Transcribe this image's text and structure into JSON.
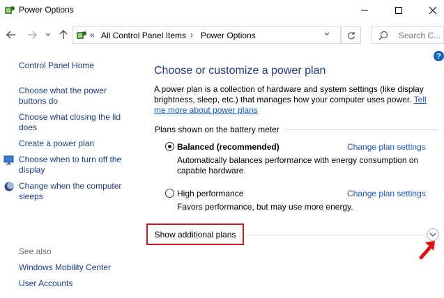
{
  "window": {
    "title": "Power Options",
    "app_icon": "power-options-icon",
    "controls": [
      "minimize-icon",
      "maximize-icon",
      "close-icon"
    ]
  },
  "navigation": {
    "back_icon": "arrow-left-icon",
    "forward_icon": "arrow-right-icon",
    "recent_icon": "chevron-down-icon",
    "up_icon": "arrow-up-icon",
    "address_prefix": "«",
    "breadcrumbs": [
      "All Control Panel Items",
      "Power Options"
    ],
    "breadcrumb_separator": "›",
    "address_dropdown_icon": "chevron-down-icon",
    "refresh_icon": "refresh-icon",
    "search_placeholder": "Search C..."
  },
  "help": {
    "label": "?"
  },
  "sidebar": {
    "home": "Control Panel Home",
    "links": [
      "Choose what the power buttons do",
      "Choose what closing the lid does",
      "Create a power plan",
      "Choose when to turn off the display",
      "Change when the computer sleeps"
    ],
    "see_also_heading": "See also",
    "see_also": [
      "Windows Mobility Center",
      "User Accounts"
    ]
  },
  "main": {
    "heading": "Choose or customize a power plan",
    "description": "A power plan is a collection of hardware and system settings (like display brightness, sleep, etc.) that manages how your computer uses power.",
    "description_link": "Tell me more about power plans",
    "section_label": "Plans shown on the battery meter",
    "plans": [
      {
        "name": "Balanced (recommended)",
        "description": "Automatically balances performance with energy consumption on capable hardware.",
        "link": "Change plan settings",
        "selected": true
      },
      {
        "name": "High performance",
        "description": "Favors performance, but may use more energy.",
        "link": "Change plan settings",
        "selected": false
      }
    ],
    "show_additional": "Show additional plans",
    "expand_icon": "chevron-down-circle-icon"
  },
  "colors": {
    "link": "#1a56c8",
    "sidebar_link": "#1a3b8a",
    "heading": "#1e3b87",
    "highlight_border": "#d01818",
    "annotation_arrow": "#e01010"
  }
}
